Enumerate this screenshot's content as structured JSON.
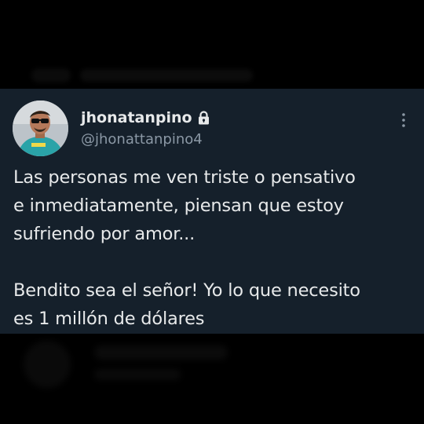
{
  "tweet": {
    "display_name": "jhonatanpino",
    "handle": "@jhonattanpino4",
    "protected_icon": "lock-icon",
    "more_icon": "more-vertical-icon",
    "text": "Las personas me ven triste o pensativo\ne inmediatamente, piensan que estoy\nsufriendo por amor...\n\nBendito sea el señor! Yo lo que necesito\nes 1 millón de dólares"
  },
  "colors": {
    "background": "#000000",
    "card": "#15202b",
    "primary_text": "#e7e9ea",
    "secondary_text": "#8b98a5"
  }
}
